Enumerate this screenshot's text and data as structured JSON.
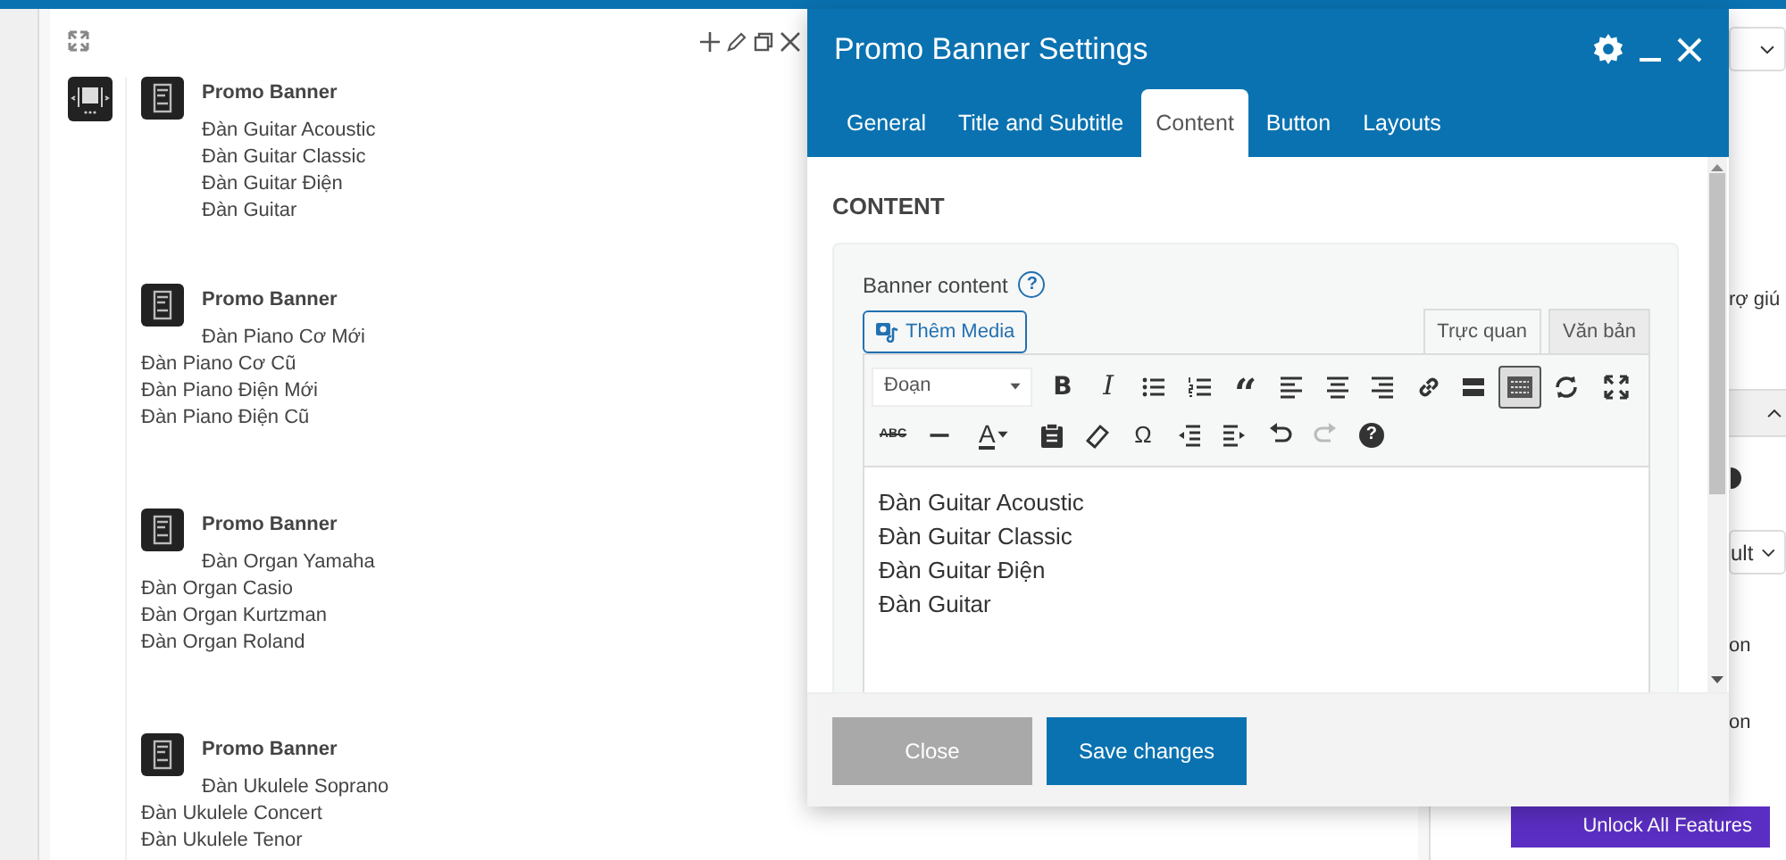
{
  "builder": {
    "blocks": [
      {
        "kind": "stacked",
        "title": "Promo Banner",
        "items": [
          "Đàn Guitar Acoustic",
          "Đàn Guitar Classic",
          "Đàn Guitar Điện",
          "Đàn Guitar"
        ]
      },
      {
        "kind": "wrapped",
        "title": "Promo Banner",
        "items": [
          "Đàn Piano Cơ Mới",
          "Đàn Piano Cơ Cũ",
          "Đàn Piano Điện Mới",
          "Đàn Piano Điện Cũ"
        ]
      },
      {
        "kind": "wrapped",
        "title": "Promo Banner",
        "items": [
          "Đàn Organ Yamaha",
          "Đàn Organ Casio",
          "Đàn Organ Kurtzman",
          "Đàn Organ Roland"
        ]
      },
      {
        "kind": "wrapped",
        "title": "Promo Banner",
        "items": [
          "Đàn Ukulele Soprano",
          "Đàn Ukulele Concert",
          "Đàn Ukulele Tenor"
        ]
      }
    ]
  },
  "modal": {
    "title": "Promo Banner Settings",
    "tabs": [
      {
        "label": "General",
        "selected": false
      },
      {
        "label": "Title and Subtitle",
        "selected": false
      },
      {
        "label": "Content",
        "selected": true
      },
      {
        "label": "Button",
        "selected": false
      },
      {
        "label": "Layouts",
        "selected": false
      }
    ],
    "section_title": "CONTENT",
    "field_label": "Banner content",
    "help_glyph": "?",
    "media_button": "Thêm Media",
    "editor_tabs": [
      {
        "label": "Trực quan",
        "selected": true
      },
      {
        "label": "Văn bản",
        "selected": false
      }
    ],
    "format_select": "Đoạn",
    "toolbar_rows": [
      [
        {
          "kind": "bold",
          "glyph": "B",
          "pressed": false,
          "disabled": false
        },
        {
          "kind": "italic",
          "glyph": "I",
          "pressed": false,
          "disabled": false
        },
        {
          "kind": "bullets",
          "pressed": false,
          "disabled": false
        },
        {
          "kind": "numbers",
          "pressed": false,
          "disabled": false
        },
        {
          "kind": "quote",
          "glyph": "“",
          "pressed": false,
          "disabled": false
        },
        {
          "kind": "alignleft",
          "pressed": false,
          "disabled": false
        },
        {
          "kind": "aligncenter",
          "pressed": false,
          "disabled": false
        },
        {
          "kind": "alignright",
          "pressed": false,
          "disabled": false
        },
        {
          "kind": "link",
          "pressed": false,
          "disabled": false
        },
        {
          "kind": "more",
          "pressed": false,
          "disabled": false
        },
        {
          "kind": "toggle",
          "pressed": true,
          "disabled": false
        },
        {
          "kind": "sync",
          "pressed": false,
          "disabled": false
        },
        {
          "kind": "fullscreen",
          "pressed": false,
          "disabled": false
        }
      ],
      [
        {
          "kind": "strike",
          "glyph": "ABC",
          "pressed": false,
          "disabled": false
        },
        {
          "kind": "hr",
          "pressed": false,
          "disabled": false
        },
        {
          "kind": "color",
          "glyph": "A",
          "pressed": false,
          "disabled": false
        },
        {
          "kind": "paste",
          "pressed": false,
          "disabled": false
        },
        {
          "kind": "eraser",
          "pressed": false,
          "disabled": false
        },
        {
          "kind": "omega",
          "glyph": "Ω",
          "pressed": false,
          "disabled": false
        },
        {
          "kind": "outdent",
          "pressed": false,
          "disabled": false
        },
        {
          "kind": "indent",
          "pressed": false,
          "disabled": false
        },
        {
          "kind": "undo",
          "pressed": false,
          "disabled": false
        },
        {
          "kind": "redo",
          "pressed": false,
          "disabled": true
        },
        {
          "kind": "help",
          "glyph": "?",
          "pressed": false,
          "disabled": false
        }
      ]
    ],
    "content_lines": [
      "Đàn Guitar Acoustic",
      "Đàn Guitar Classic",
      "Đàn Guitar Điện",
      "Đàn Guitar"
    ],
    "buttons": [
      {
        "label": "Close",
        "disabled": true
      },
      {
        "label": "Save changes",
        "disabled": false
      }
    ]
  },
  "sidebar": {
    "items": [
      {
        "kind": "select"
      },
      {
        "kind": "text",
        "text": "rợ giú"
      },
      {
        "kind": "bar"
      },
      {
        "kind": "dot"
      },
      {
        "kind": "select",
        "text": "ult"
      },
      {
        "kind": "text",
        "text": "on"
      },
      {
        "kind": "text",
        "text": "on"
      },
      {
        "kind": "button",
        "text": "Unlock All Features"
      }
    ]
  }
}
